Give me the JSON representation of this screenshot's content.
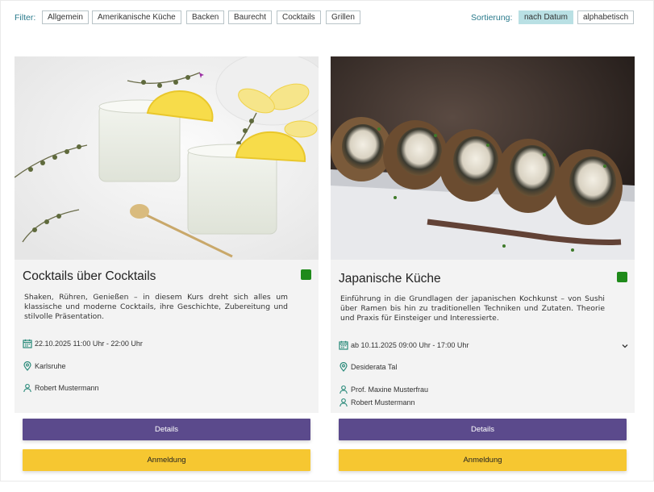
{
  "filter": {
    "label": "Filter:",
    "chips": [
      "Allgemein",
      "Amerikanische Küche",
      "Backen",
      "Baurecht",
      "Cocktails",
      "Grillen"
    ]
  },
  "sort": {
    "label": "Sortierung:",
    "options": [
      "nach Datum",
      "alphabetisch"
    ],
    "active": "nach Datum"
  },
  "courses": [
    {
      "title": "Cocktails über Cocktails",
      "description": "Shaken, Rühren, Genießen – in diesem Kurs dreht sich alles um klassische und moderne Cocktails, ihre Geschichte, Zubereitung und stilvolle Präsentation.",
      "date": "22.10.2025 11:00 Uhr - 22:00 Uhr",
      "location": "Karlsruhe",
      "instructors": [
        "Robert Mustermann"
      ],
      "details_label": "Details",
      "register_label": "Anmeldung",
      "status_color": "#1f8a1a"
    },
    {
      "title": "Japanische Küche",
      "description": "Einführung in die Grundlagen der japanischen Kochkunst – von Sushi über Ramen bis hin zu traditionellen Techniken und Zutaten. Theorie und Praxis für Einsteiger und Interessierte.",
      "date": "ab 10.11.2025 09:00 Uhr - 17:00 Uhr",
      "location": "Desiderata Tal",
      "instructors": [
        "Prof. Maxine Musterfrau",
        "Robert Mustermann"
      ],
      "details_label": "Details",
      "register_label": "Anmeldung",
      "status_color": "#1f8a1a"
    }
  ],
  "colors": {
    "accent": "#2a7a8c",
    "details_button": "#5b4a8c",
    "register_button": "#f6c731",
    "status": "#1f8a1a"
  }
}
